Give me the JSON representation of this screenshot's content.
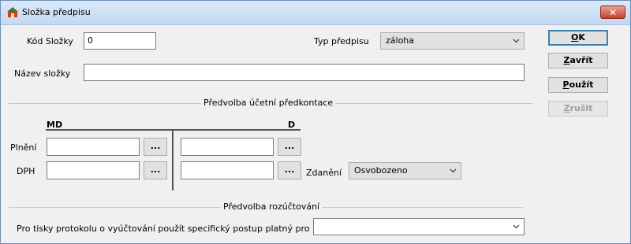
{
  "window": {
    "title": "Složka předpisu",
    "close_label": "✕"
  },
  "fields": {
    "kod_label": "Kód Složky",
    "kod_value": "0",
    "typ_label": "Typ předpisu",
    "typ_value": "záloha",
    "nazev_label": "Název složky",
    "nazev_value": ""
  },
  "sections": {
    "predkontace_title": "Předvolba účetní předkontace",
    "rozuctovani_title": "Předvolba rozúčtování"
  },
  "columns": {
    "md": "MD",
    "d": "D"
  },
  "rows": {
    "plneni_label": "Plnění",
    "dph_label": "DPH",
    "browse_label": "...",
    "zdaneni_label": "Zdanění",
    "zdaneni_value": "Osvobozeno"
  },
  "rozuctovani": {
    "label": "Pro tisky protokolu o vyúčtování použít specifický postup platný pro",
    "value": ""
  },
  "buttons": {
    "ok_accel": "O",
    "ok_rest": "K",
    "zavrit_accel": "Z",
    "zavrit_rest": "avřít",
    "pouzit_accel": "P",
    "pouzit_rest": "oužít",
    "zrusit_accel": "Z",
    "zrusit_rest": "rušit"
  },
  "icons": {
    "window": "app-house-icon",
    "dropdown": "chevron-down-icon",
    "close": "close-icon"
  }
}
